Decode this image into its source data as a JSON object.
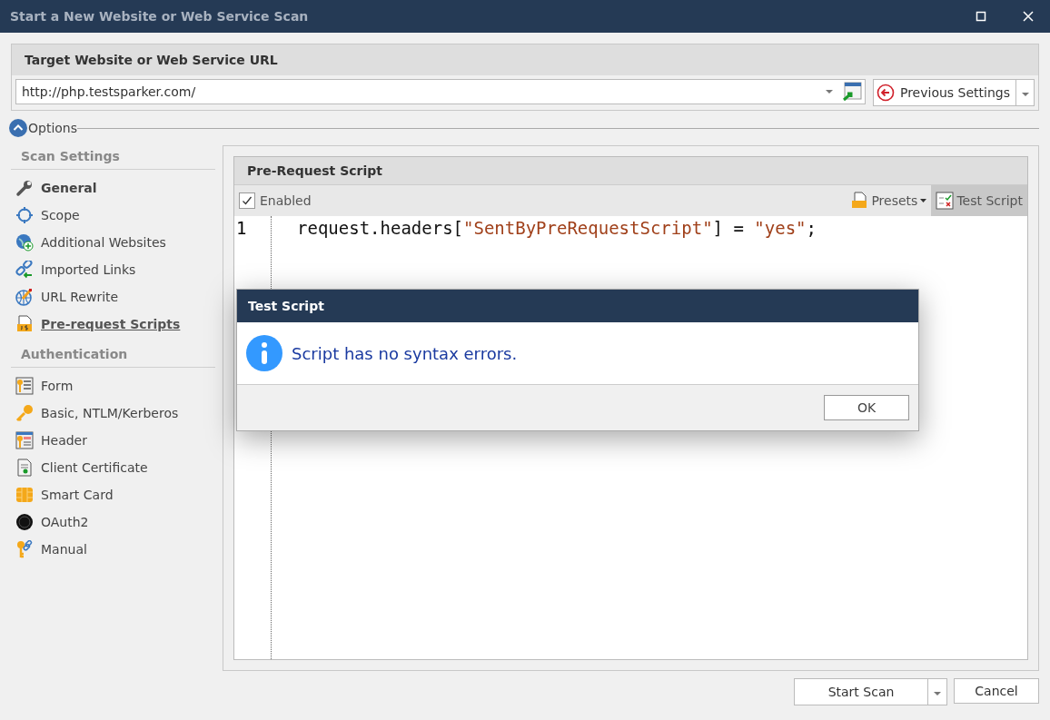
{
  "window": {
    "title": "Start a New Website or Web Service Scan"
  },
  "target": {
    "heading": "Target Website or Web Service URL",
    "url": "http://php.testsparker.com/",
    "previous_settings": "Previous Settings"
  },
  "options": {
    "label": "Options",
    "expanded": true
  },
  "sidebar": {
    "sections": [
      {
        "title": "Scan Settings",
        "items": [
          {
            "label": "General",
            "selected": false,
            "bold": true
          },
          {
            "label": "Scope",
            "selected": false,
            "bold": false
          },
          {
            "label": "Additional Websites",
            "selected": false,
            "bold": false
          },
          {
            "label": "Imported Links",
            "selected": false,
            "bold": false
          },
          {
            "label": "URL Rewrite",
            "selected": false,
            "bold": false
          },
          {
            "label": "Pre-request Scripts",
            "selected": true,
            "bold": true
          }
        ]
      },
      {
        "title": "Authentication",
        "items": [
          {
            "label": "Form",
            "selected": false,
            "bold": false
          },
          {
            "label": "Basic, NTLM/Kerberos",
            "selected": false,
            "bold": false
          },
          {
            "label": "Header",
            "selected": false,
            "bold": false
          },
          {
            "label": "Client Certificate",
            "selected": false,
            "bold": false
          },
          {
            "label": "Smart Card",
            "selected": false,
            "bold": false
          },
          {
            "label": "OAuth2",
            "selected": false,
            "bold": false
          },
          {
            "label": "Manual",
            "selected": false,
            "bold": false
          }
        ]
      }
    ]
  },
  "editor": {
    "heading": "Pre-Request Script",
    "enabled": {
      "label": "Enabled",
      "checked": true
    },
    "presets": "Presets",
    "test_script": "Test Script",
    "lines": [
      {
        "number": "1",
        "tokens": [
          {
            "text": "request.headers[",
            "kind": "plain"
          },
          {
            "text": "\"SentByPreRequestScript\"",
            "kind": "string"
          },
          {
            "text": "] = ",
            "kind": "plain"
          },
          {
            "text": "\"yes\"",
            "kind": "string"
          },
          {
            "text": ";",
            "kind": "plain"
          }
        ]
      }
    ]
  },
  "dialog": {
    "title": "Test Script",
    "message": "Script has no syntax errors.",
    "ok": "OK"
  },
  "buttons": {
    "start": "Start Scan",
    "cancel": "Cancel"
  }
}
